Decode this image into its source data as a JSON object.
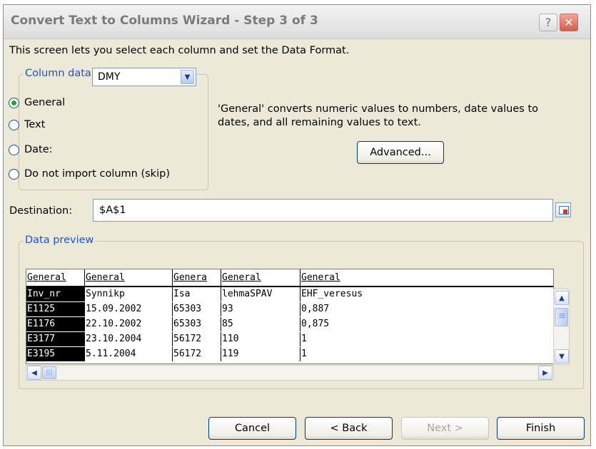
{
  "window": {
    "title": "Convert Text to Columns Wizard - Step 3 of 3",
    "help_label": "?",
    "close_label": "✕"
  },
  "intro_text": "This screen lets you select each column and set the Data Format.",
  "column_format": {
    "group_label": "Column data format",
    "options": [
      {
        "label": "General",
        "checked": true
      },
      {
        "label": "Text",
        "checked": false
      },
      {
        "label": "Date:",
        "checked": false
      },
      {
        "label": "Do not import column (skip)",
        "checked": false
      }
    ],
    "date_value": "DMY"
  },
  "description": "'General' converts numeric values to numbers, date values to dates, and all remaining values to text.",
  "advanced_label": "Advanced...",
  "destination": {
    "label": "Destination:",
    "value": "$A$1"
  },
  "data_preview": {
    "group_label": "Data preview",
    "headers": [
      "General",
      "General",
      "General",
      "General",
      "General"
    ],
    "header_display": [
      "General",
      "General",
      "Genera",
      "General",
      "General"
    ],
    "rows": [
      [
        "Inv_nr",
        "Synnikp",
        "Isa",
        "lehmaSPAV",
        "EHF_veresus"
      ],
      [
        "E1125",
        "15.09.2002",
        "65303",
        "93",
        "0,887"
      ],
      [
        "E1176",
        "22.10.2002",
        "65303",
        "85",
        "0,875"
      ],
      [
        "E3177",
        "23.10.2004",
        "56172",
        "110",
        "1"
      ],
      [
        "E3195",
        "5.11.2004",
        "56172",
        "119",
        "1"
      ]
    ],
    "selected_column": 0
  },
  "buttons": {
    "cancel": "Cancel",
    "back": "< Back",
    "next": "Next >",
    "finish": "Finish"
  }
}
